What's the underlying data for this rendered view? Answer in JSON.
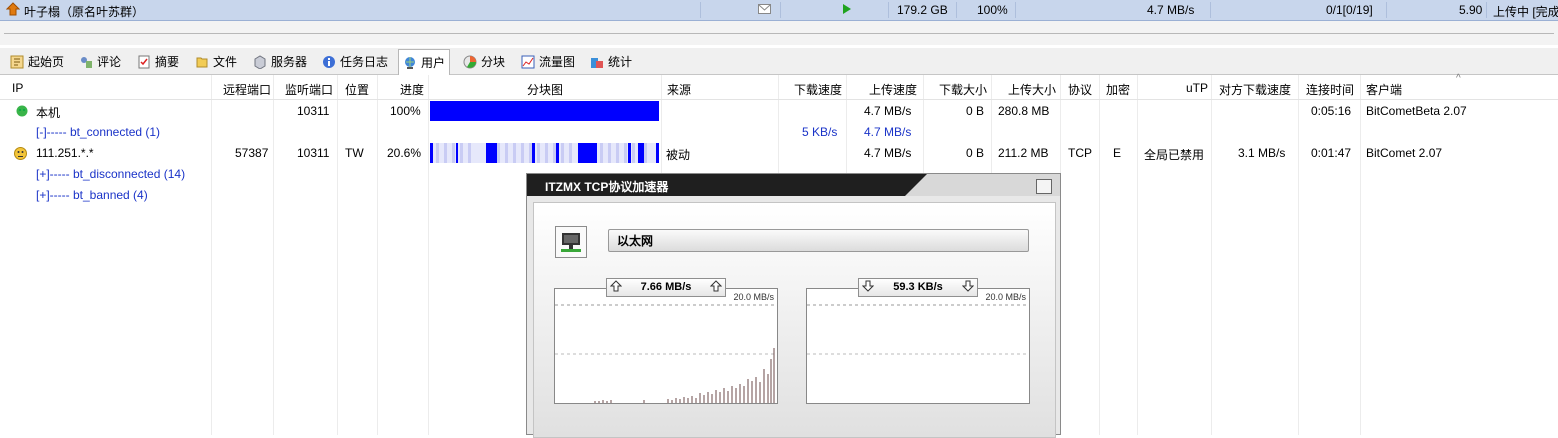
{
  "task": {
    "name": "叶子榻（原名叶苏群）",
    "size": "179.2 GB",
    "progress": "100%",
    "speed": "4.7 MB/s",
    "peers": "0/1[0/19]",
    "ratio": "5.90",
    "status": "上传中 [完成"
  },
  "tabs": [
    {
      "label": "起始页",
      "icon": "start-page-icon"
    },
    {
      "label": "评论",
      "icon": "comment-icon"
    },
    {
      "label": "摘要",
      "icon": "summary-icon"
    },
    {
      "label": "文件",
      "icon": "file-icon"
    },
    {
      "label": "服务器",
      "icon": "server-icon"
    },
    {
      "label": "任务日志",
      "icon": "info-icon"
    },
    {
      "label": "用户",
      "icon": "users-icon"
    },
    {
      "label": "分块",
      "icon": "pie-icon"
    },
    {
      "label": "流量图",
      "icon": "chart-icon"
    },
    {
      "label": "统计",
      "icon": "stats-icon"
    }
  ],
  "columns": {
    "ip": "IP",
    "remote_port": "远程端口",
    "listen_port": "监听端口",
    "location": "位置",
    "progress": "进度",
    "pieces": "分块图",
    "source": "来源",
    "down_speed": "下载速度",
    "up_speed": "上传速度",
    "down_size": "下载大小",
    "up_size": "上传大小",
    "protocol": "协议",
    "encrypt": "加密",
    "utp": "uTP",
    "peer_down": "对方下载速度",
    "conn_time": "连接时间",
    "client": "客户端"
  },
  "rows": {
    "local": {
      "ip": "本机",
      "listen_port": "10311",
      "progress": "100%",
      "up_speed": "4.7 MB/s",
      "down_size": "0 B",
      "up_size": "280.8 MB",
      "conn_time": "0:05:16",
      "client": "BitCometBeta 2.07"
    },
    "connected": {
      "label": "[-]----- bt_connected (1)",
      "down_speed": "5 KB/s",
      "up_speed": "4.7 MB/s"
    },
    "peer": {
      "ip": "111.251.*.*",
      "remote_port": "57387",
      "listen_port": "10311",
      "location": "TW",
      "progress": "20.6%",
      "source": "被动",
      "up_speed": "4.7 MB/s",
      "down_size": "0 B",
      "up_size": "211.2 MB",
      "protocol": "TCP",
      "encrypt": "E",
      "utp": "全局已禁用",
      "peer_down": "3.1 MB/s",
      "conn_time": "0:01:47",
      "client": "BitComet 2.07"
    },
    "disconnected": {
      "label": "[+]----- bt_disconnected (14)"
    },
    "banned": {
      "label": "[+]----- bt_banned (4)"
    }
  },
  "accelerator": {
    "title": "ITZMX TCP协议加速器",
    "adapter": "以太网",
    "upload": {
      "speed": "7.66 MB/s",
      "max": "20.0 MB/s"
    },
    "download": {
      "speed": "59.3 KB/s",
      "max": "20.0 MB/s"
    }
  },
  "colors": {
    "piece_blue": "#0000ff",
    "link_blue": "#1a33c8",
    "task_bg": "#c8d6ec"
  }
}
